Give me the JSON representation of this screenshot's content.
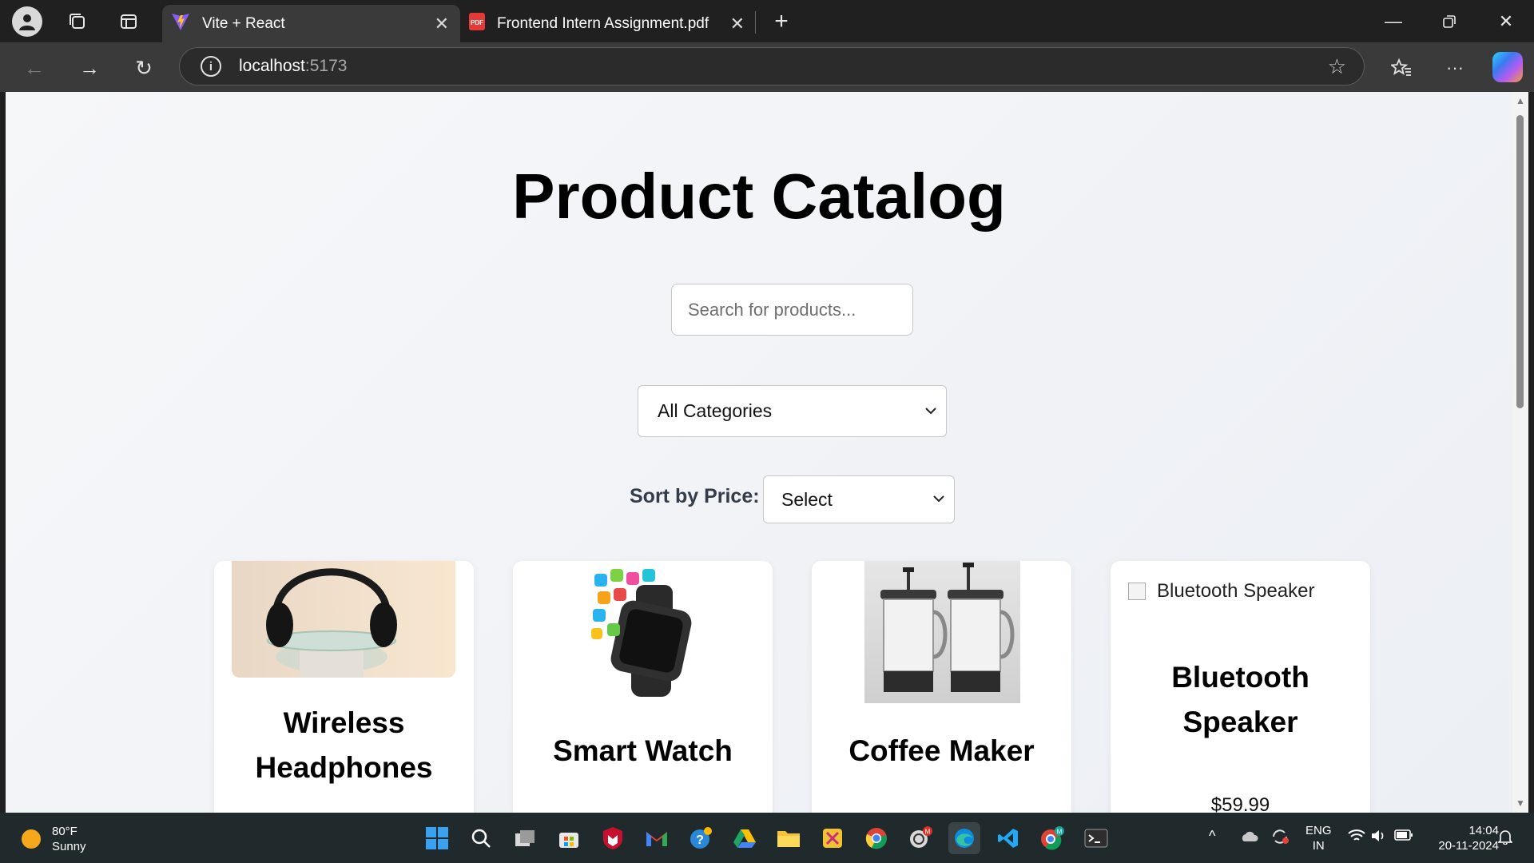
{
  "browser": {
    "tabs": [
      {
        "title": "Vite + React",
        "active": true
      },
      {
        "title": "Frontend Intern Assignment.pdf",
        "active": false
      }
    ],
    "address": {
      "host": "localhost",
      "port": ":5173"
    }
  },
  "page": {
    "title": "Product Catalog",
    "search_placeholder": "Search for products...",
    "category_select": {
      "selected": "All Categories"
    },
    "sort": {
      "label": "Sort by Price:",
      "selected": "Select"
    },
    "products": [
      {
        "name": "Wireless Headphones",
        "image": "headphones"
      },
      {
        "name": "Smart Watch",
        "image": "smartwatch"
      },
      {
        "name": "Coffee Maker",
        "image": "coffee-maker"
      },
      {
        "name": "Bluetooth Speaker",
        "image_alt": "Bluetooth Speaker",
        "price": "$59.99"
      }
    ]
  },
  "taskbar": {
    "weather": {
      "temp": "80°F",
      "condition": "Sunny"
    },
    "language": {
      "lang": "ENG",
      "region": "IN"
    },
    "clock": {
      "time": "14:04",
      "date": "20-11-2024"
    }
  },
  "colors": {
    "page_bg": "#eef1f5",
    "accent_edge": "#0f6cbd"
  }
}
